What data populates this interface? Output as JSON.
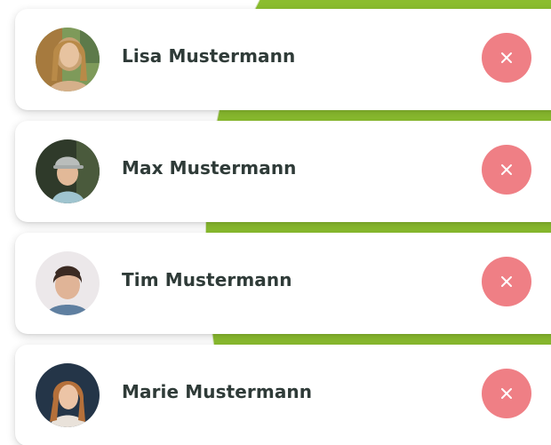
{
  "colors": {
    "accent_green": "#8bbd2f",
    "remove_button": "#ef7f85",
    "name_text": "#2f3b38"
  },
  "contacts": [
    {
      "name": "Lisa Mustermann",
      "avatar": "lisa-photo",
      "remove_icon": "close-icon"
    },
    {
      "name": "Max Mustermann",
      "avatar": "max-photo",
      "remove_icon": "close-icon"
    },
    {
      "name": "Tim Mustermann",
      "avatar": "tim-photo",
      "remove_icon": "close-icon"
    },
    {
      "name": "Marie Mustermann",
      "avatar": "marie-photo",
      "remove_icon": "close-icon"
    }
  ]
}
